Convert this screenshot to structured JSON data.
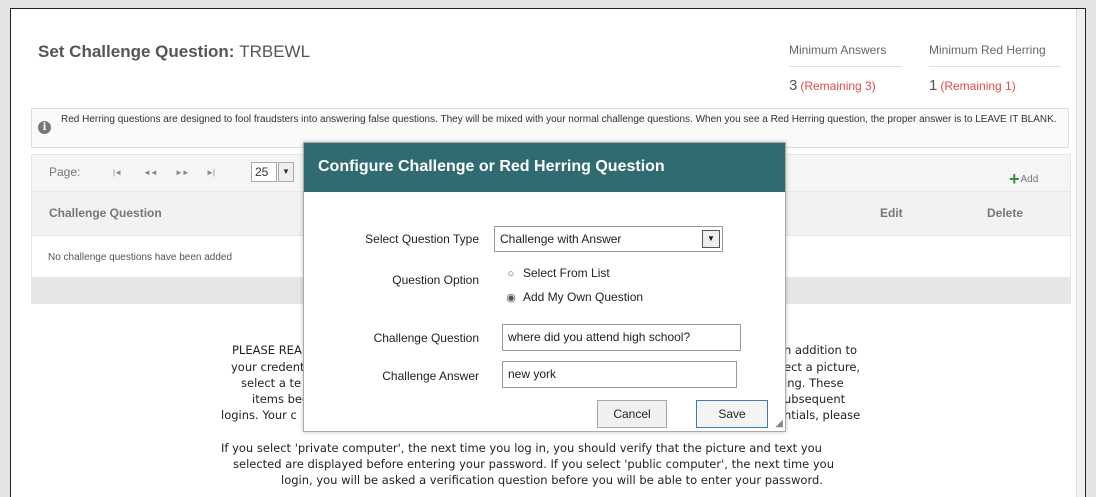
{
  "header": {
    "title_prefix": "Set Challenge Question: ",
    "username": "TRBEWL"
  },
  "metrics": {
    "min_answers": {
      "label": "Minimum Answers",
      "value": "3",
      "remaining": "(Remaining 3)"
    },
    "min_red_herring": {
      "label": "Minimum Red Herring",
      "value": "1",
      "remaining": "(Remaining 1)"
    },
    "accent_color": "#e24b4b"
  },
  "info": {
    "icon": "info-icon",
    "text": "Red Herring questions are designed to fool fraudsters into answering false questions. They will be mixed with your normal challenge questions. When you see a Red Herring question, the proper answer is to LEAVE IT BLANK."
  },
  "grid": {
    "pager_label": "Page:",
    "first": "|◄",
    "prev": "◄◄",
    "next": "►►",
    "last": "►|",
    "page_size": "25",
    "add_label": "Add",
    "columns": {
      "question": "Challenge Question",
      "edit": "Edit",
      "delete": "Delete"
    },
    "empty_message": "No challenge questions have been added"
  },
  "legal": {
    "lines": [
      [
        "PLEASE REA",
        "n addition to"
      ],
      [
        "your credent",
        "ect a picture,"
      ],
      [
        "select a te",
        "ing. These"
      ],
      [
        "items bec",
        "ubsequent"
      ],
      [
        "logins. Your c",
        "ntials, please"
      ]
    ],
    "paragraph2": [
      "If you select 'private computer', the next time you log in, you should verify that the picture and text you",
      "selected are displayed before entering your password. If you select 'public computer', the next time you",
      "login, you will be asked a verification question before you will be able to enter your password."
    ]
  },
  "modal": {
    "title": "Configure Challenge or Red Herring Question",
    "question_type_label": "Select Question Type",
    "question_type_value": "Challenge with Answer",
    "question_option_label": "Question Option",
    "option_list": "Select From List",
    "option_own": "Add My Own Question",
    "challenge_question_label": "Challenge Question",
    "challenge_question_value": "where did you attend high school?",
    "challenge_answer_label": "Challenge Answer",
    "challenge_answer_value": "new york",
    "cancel_label": "Cancel",
    "save_label": "Save",
    "header_color": "#2f6b70"
  }
}
